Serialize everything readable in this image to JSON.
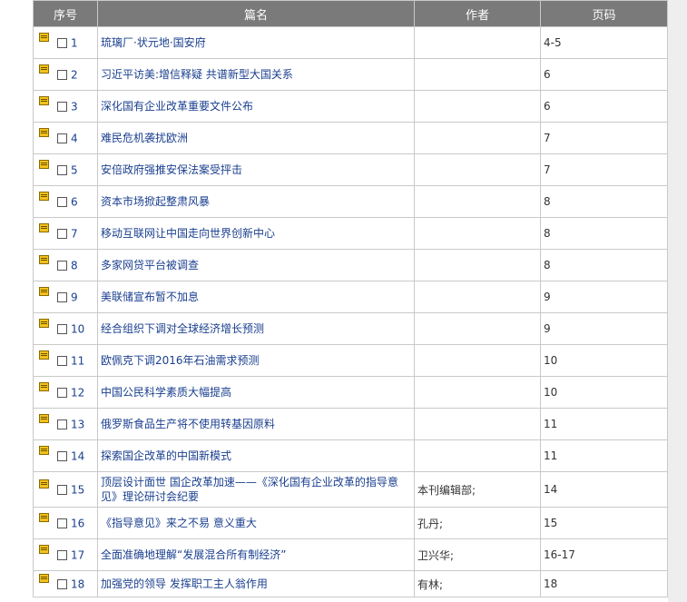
{
  "table": {
    "headers": {
      "index": "序号",
      "title": "篇名",
      "author": "作者",
      "pages": "页码"
    },
    "rows": [
      {
        "index": "1",
        "title": "琉璃厂·状元地·国安府",
        "author": "",
        "pages": "4-5"
      },
      {
        "index": "2",
        "title": "习近平访美:增信释疑 共谱新型大国关系",
        "author": "",
        "pages": "6"
      },
      {
        "index": "3",
        "title": "深化国有企业改革重要文件公布",
        "author": "",
        "pages": "6"
      },
      {
        "index": "4",
        "title": "难民危机袭扰欧洲",
        "author": "",
        "pages": "7"
      },
      {
        "index": "5",
        "title": "安倍政府强推安保法案受抨击",
        "author": "",
        "pages": "7"
      },
      {
        "index": "6",
        "title": "资本市场掀起整肃风暴",
        "author": "",
        "pages": "8"
      },
      {
        "index": "7",
        "title": "移动互联网让中国走向世界创新中心",
        "author": "",
        "pages": "8"
      },
      {
        "index": "8",
        "title": "多家网贷平台被调查",
        "author": "",
        "pages": "8"
      },
      {
        "index": "9",
        "title": "美联储宣布暂不加息",
        "author": "",
        "pages": "9"
      },
      {
        "index": "10",
        "title": "经合组织下调对全球经济增长预测",
        "author": "",
        "pages": "9"
      },
      {
        "index": "11",
        "title": "欧佩克下调2016年石油需求预测",
        "author": "",
        "pages": "10"
      },
      {
        "index": "12",
        "title": "中国公民科学素质大幅提高",
        "author": "",
        "pages": "10"
      },
      {
        "index": "13",
        "title": "俄罗斯食品生产将不使用转基因原料",
        "author": "",
        "pages": "11"
      },
      {
        "index": "14",
        "title": "探索国企改革的中国新模式",
        "author": "",
        "pages": "11"
      },
      {
        "index": "15",
        "title": "顶层设计面世 国企改革加速——《深化国有企业改革的指导意见》理论研讨会纪要",
        "author": "本刊编辑部;",
        "pages": "14"
      },
      {
        "index": "16",
        "title": "《指导意见》来之不易 意义重大",
        "author": "孔丹;",
        "pages": "15"
      },
      {
        "index": "17",
        "title": "全面准确地理解“发展混合所有制经济”",
        "author": "卫兴华;",
        "pages": "16-17"
      },
      {
        "index": "18",
        "title": "加强党的领导 发挥职工主人翁作用",
        "author": "有林;",
        "pages": "18"
      }
    ]
  }
}
